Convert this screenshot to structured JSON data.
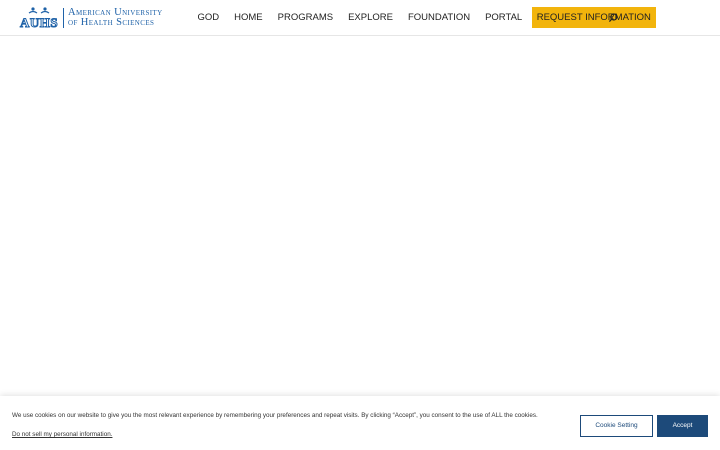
{
  "logo": {
    "mark": "AUHS",
    "line1": "American University",
    "line2": "of Health Sciences"
  },
  "nav": {
    "items": [
      {
        "label": "GOD"
      },
      {
        "label": "HOME"
      },
      {
        "label": "PROGRAMS"
      },
      {
        "label": "EXPLORE"
      },
      {
        "label": "FOUNDATION"
      },
      {
        "label": "PORTAL"
      }
    ],
    "cta_label": "REQUEST INFORMATION",
    "search_icon": "search-icon"
  },
  "cookie": {
    "message": "We use cookies on our website to give you the most relevant experience by remembering your preferences and repeat visits. By clicking “Accept”, you consent to the use of ALL the cookies.",
    "link_label": "Do not sell my personal information.",
    "settings_label": "Cookie Setting",
    "accept_label": "Accept"
  },
  "colors": {
    "brand_blue": "#1f62a8",
    "cta_yellow": "#f2b40c",
    "button_navy": "#1d4a7a"
  }
}
